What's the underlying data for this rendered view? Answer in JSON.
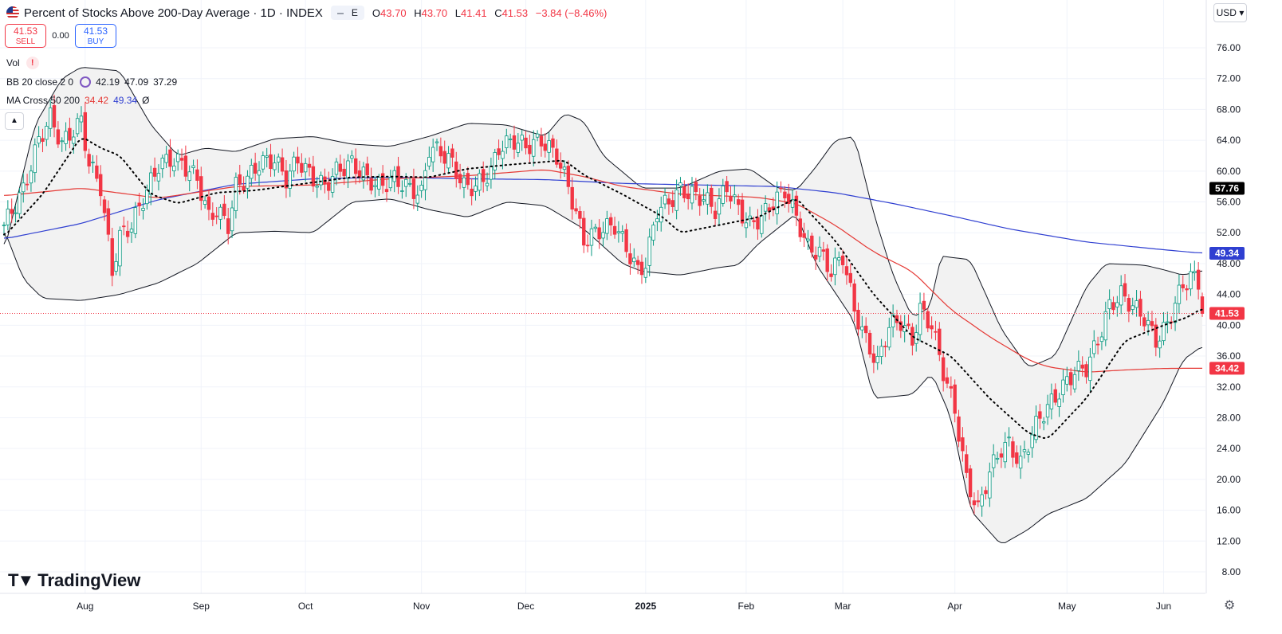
{
  "header": {
    "title": "Percent of Stocks Above 200-Day Average · 1D · INDEX",
    "badge": "E",
    "ohlc": [
      {
        "k": "O",
        "v": "43.70"
      },
      {
        "k": "H",
        "v": "43.70"
      },
      {
        "k": "L",
        "v": "41.41"
      },
      {
        "k": "C",
        "v": "41.53"
      }
    ],
    "change": "−3.84 (−8.46%)"
  },
  "trade": {
    "sell_price": "41.53",
    "sell_label": "SELL",
    "spread": "0.00",
    "buy_price": "41.53",
    "buy_label": "BUY"
  },
  "indicators": {
    "vol": "Vol",
    "bb_label": "BB 20 close 2 0",
    "bb_values": [
      "42.19",
      "47.09",
      "37.29"
    ],
    "ma_label": "MA Cross 50 200",
    "ma_values": [
      "34.42",
      "49.34"
    ],
    "ma_extra": "Ø"
  },
  "currency": "USD",
  "brand": "TradingView",
  "colors": {
    "up": "#089981",
    "down": "#f23645",
    "ma50": "#e53935",
    "ma200": "#2f3fd1",
    "bb": "#131722",
    "bb_fill": "#f2f2f2",
    "basis": "#000000"
  },
  "chart_data": {
    "type": "candlestick",
    "ylim": [
      6,
      78
    ],
    "yticks": [
      76,
      72,
      68,
      64,
      60,
      56,
      52,
      48,
      44,
      40,
      36,
      32,
      28,
      24,
      20,
      16,
      12,
      8
    ],
    "x_labels": [
      "Aug",
      "Sep",
      "Oct",
      "Nov",
      "Dec",
      "2025",
      "Feb",
      "Mar",
      "Apr",
      "May",
      "Jun"
    ],
    "x_label_index": [
      21,
      51,
      78,
      108,
      135,
      166,
      192,
      217,
      246,
      275,
      300
    ],
    "last_value": 41.53,
    "value_labels": [
      {
        "v": 57.76,
        "text": "57.76",
        "color": "#000000"
      },
      {
        "v": 49.34,
        "text": "49.34",
        "color": "#2f3fd1"
      },
      {
        "v": 41.53,
        "text": "41.53",
        "color": "#f23645"
      },
      {
        "v": 34.42,
        "text": "34.42",
        "color": "#f23645"
      }
    ],
    "ma50_anchors": [
      [
        0,
        56.8
      ],
      [
        20,
        57.8
      ],
      [
        40,
        56.5
      ],
      [
        60,
        58.0
      ],
      [
        80,
        58.2
      ],
      [
        100,
        59.0
      ],
      [
        120,
        59.4
      ],
      [
        140,
        60.2
      ],
      [
        150,
        59.3
      ],
      [
        160,
        58.0
      ],
      [
        175,
        57.0
      ],
      [
        195,
        56.6
      ],
      [
        205,
        55.8
      ],
      [
        215,
        53.0
      ],
      [
        225,
        49.5
      ],
      [
        235,
        47.0
      ],
      [
        245,
        42.0
      ],
      [
        255,
        38.5
      ],
      [
        265,
        35.5
      ],
      [
        270,
        34.6
      ],
      [
        280,
        33.9
      ],
      [
        290,
        34.2
      ],
      [
        300,
        34.4
      ],
      [
        310,
        34.42
      ]
    ],
    "ma200_anchors": [
      [
        0,
        51.2
      ],
      [
        20,
        53.2
      ],
      [
        40,
        56.3
      ],
      [
        60,
        58.3
      ],
      [
        80,
        59.0
      ],
      [
        100,
        59.2
      ],
      [
        120,
        59.0
      ],
      [
        140,
        58.9
      ],
      [
        160,
        58.4
      ],
      [
        180,
        58.2
      ],
      [
        200,
        58.0
      ],
      [
        215,
        57.2
      ],
      [
        230,
        55.8
      ],
      [
        245,
        54.2
      ],
      [
        260,
        52.5
      ],
      [
        280,
        50.8
      ],
      [
        300,
        49.8
      ],
      [
        310,
        49.34
      ]
    ],
    "basis_anchors": [
      [
        0,
        51.5
      ],
      [
        10,
        57
      ],
      [
        20,
        64.5
      ],
      [
        25,
        63
      ],
      [
        30,
        62
      ],
      [
        38,
        57
      ],
      [
        45,
        55.8
      ],
      [
        55,
        57.2
      ],
      [
        65,
        57.5
      ],
      [
        75,
        58.2
      ],
      [
        90,
        59.2
      ],
      [
        100,
        59.3
      ],
      [
        110,
        59.2
      ],
      [
        120,
        60.3
      ],
      [
        130,
        60.8
      ],
      [
        140,
        61.2
      ],
      [
        145,
        61.4
      ],
      [
        150,
        59.5
      ],
      [
        160,
        57.0
      ],
      [
        170,
        54.2
      ],
      [
        175,
        52.0
      ],
      [
        185,
        53.0
      ],
      [
        195,
        54.0
      ],
      [
        205,
        56.5
      ],
      [
        215,
        51.0
      ],
      [
        225,
        44.0
      ],
      [
        235,
        38.5
      ],
      [
        245,
        36.0
      ],
      [
        255,
        30.5
      ],
      [
        265,
        26.0
      ],
      [
        270,
        25.2
      ],
      [
        280,
        30.5
      ],
      [
        290,
        38.0
      ],
      [
        300,
        40.0
      ],
      [
        306,
        41.0
      ],
      [
        310,
        42.19
      ]
    ],
    "upper_anchors": [
      [
        0,
        49.5
      ],
      [
        8,
        66
      ],
      [
        15,
        72
      ],
      [
        20,
        73.5
      ],
      [
        30,
        73
      ],
      [
        38,
        66
      ],
      [
        45,
        62
      ],
      [
        52,
        63
      ],
      [
        60,
        62.5
      ],
      [
        70,
        64.2
      ],
      [
        80,
        64.5
      ],
      [
        90,
        63.5
      ],
      [
        100,
        63.2
      ],
      [
        110,
        64.5
      ],
      [
        120,
        66.2
      ],
      [
        130,
        66.0
      ],
      [
        140,
        64.5
      ],
      [
        145,
        67.5
      ],
      [
        150,
        66.5
      ],
      [
        155,
        62
      ],
      [
        165,
        57.8
      ],
      [
        175,
        57.8
      ],
      [
        185,
        60.0
      ],
      [
        193,
        60.3
      ],
      [
        200,
        57.8
      ],
      [
        205,
        57.5
      ],
      [
        210,
        60.5
      ],
      [
        215,
        64.0
      ],
      [
        220,
        64.5
      ],
      [
        225,
        54.5
      ],
      [
        230,
        46.5
      ],
      [
        235,
        41.0
      ],
      [
        240,
        42.5
      ],
      [
        242,
        49.0
      ],
      [
        250,
        48.5
      ],
      [
        258,
        39.5
      ],
      [
        265,
        34.5
      ],
      [
        272,
        36.0
      ],
      [
        280,
        45.0
      ],
      [
        285,
        48.0
      ],
      [
        295,
        47.8
      ],
      [
        300,
        47.2
      ],
      [
        305,
        46.5
      ],
      [
        310,
        47.09
      ]
    ],
    "lower_anchors": [
      [
        0,
        52.5
      ],
      [
        5,
        46
      ],
      [
        10,
        43.5
      ],
      [
        20,
        43.2
      ],
      [
        30,
        44.0
      ],
      [
        40,
        45.5
      ],
      [
        50,
        48.0
      ],
      [
        60,
        52.0
      ],
      [
        70,
        52.2
      ],
      [
        80,
        52.0
      ],
      [
        90,
        56.0
      ],
      [
        100,
        56.4
      ],
      [
        110,
        55.0
      ],
      [
        120,
        54.0
      ],
      [
        130,
        56.0
      ],
      [
        140,
        55.5
      ],
      [
        150,
        52.5
      ],
      [
        160,
        48.0
      ],
      [
        165,
        47.0
      ],
      [
        175,
        46.5
      ],
      [
        185,
        47.5
      ],
      [
        190,
        47.8
      ],
      [
        195,
        50.5
      ],
      [
        205,
        54.5
      ],
      [
        210,
        48.0
      ],
      [
        220,
        40.5
      ],
      [
        225,
        30.5
      ],
      [
        235,
        31.0
      ],
      [
        240,
        33.8
      ],
      [
        245,
        28.0
      ],
      [
        250,
        16.0
      ],
      [
        258,
        11.5
      ],
      [
        265,
        13.5
      ],
      [
        270,
        15.5
      ],
      [
        280,
        17.5
      ],
      [
        290,
        22.0
      ],
      [
        300,
        30.0
      ],
      [
        305,
        35.5
      ],
      [
        310,
        37.29
      ]
    ],
    "close_anchors": [
      [
        0,
        53.0
      ],
      [
        5,
        57.5
      ],
      [
        9,
        64
      ],
      [
        12,
        67
      ],
      [
        15,
        63.5
      ],
      [
        20,
        66.5
      ],
      [
        22,
        61
      ],
      [
        25,
        58
      ],
      [
        28,
        47
      ],
      [
        30,
        51.5
      ],
      [
        33,
        53
      ],
      [
        37,
        57.5
      ],
      [
        40,
        60.8
      ],
      [
        43,
        61.5
      ],
      [
        46,
        61
      ],
      [
        50,
        59
      ],
      [
        53,
        54
      ],
      [
        55,
        55
      ],
      [
        58,
        53
      ],
      [
        60,
        58
      ],
      [
        63,
        59
      ],
      [
        66,
        61
      ],
      [
        70,
        61.5
      ],
      [
        73,
        59
      ],
      [
        76,
        61.5
      ],
      [
        80,
        59
      ],
      [
        83,
        58
      ],
      [
        86,
        60
      ],
      [
        90,
        61
      ],
      [
        94,
        59
      ],
      [
        97,
        58
      ],
      [
        101,
        59
      ],
      [
        104,
        58
      ],
      [
        108,
        57
      ],
      [
        110,
        63
      ],
      [
        113,
        62.5
      ],
      [
        116,
        61
      ],
      [
        119,
        58
      ],
      [
        122,
        58
      ],
      [
        126,
        60
      ],
      [
        128,
        63
      ],
      [
        130,
        63.5
      ],
      [
        132,
        64
      ],
      [
        135,
        63.2
      ],
      [
        139,
        64
      ],
      [
        143,
        62
      ],
      [
        146,
        58
      ],
      [
        150,
        51
      ],
      [
        153,
        52
      ],
      [
        155,
        52.5
      ],
      [
        158,
        53
      ],
      [
        161,
        50
      ],
      [
        164,
        47
      ],
      [
        166,
        48
      ],
      [
        169,
        55
      ],
      [
        172,
        56
      ],
      [
        175,
        57.5
      ],
      [
        178,
        57
      ],
      [
        181,
        56.5
      ],
      [
        184,
        55
      ],
      [
        187,
        58
      ],
      [
        190,
        55
      ],
      [
        193,
        53
      ],
      [
        196,
        54
      ],
      [
        199,
        56
      ],
      [
        202,
        57.5
      ],
      [
        205,
        54
      ],
      [
        208,
        50
      ],
      [
        211,
        49.5
      ],
      [
        214,
        47
      ],
      [
        217,
        49
      ],
      [
        220,
        42
      ],
      [
        223,
        38
      ],
      [
        226,
        35
      ],
      [
        229,
        40
      ],
      [
        232,
        40.5
      ],
      [
        235,
        38
      ],
      [
        237,
        42
      ],
      [
        240,
        40
      ],
      [
        243,
        34
      ],
      [
        246,
        29
      ],
      [
        249,
        20
      ],
      [
        252,
        16
      ],
      [
        255,
        21
      ],
      [
        258,
        24
      ],
      [
        260,
        24.5
      ],
      [
        263,
        22
      ],
      [
        266,
        26
      ],
      [
        268,
        28
      ],
      [
        271,
        30
      ],
      [
        274,
        32
      ],
      [
        277,
        34
      ],
      [
        280,
        34.5
      ],
      [
        283,
        38
      ],
      [
        286,
        42.5
      ],
      [
        289,
        44
      ],
      [
        292,
        42.5
      ],
      [
        295,
        41
      ],
      [
        298,
        38
      ],
      [
        301,
        40
      ],
      [
        303,
        43
      ],
      [
        305,
        45
      ],
      [
        307,
        46.5
      ],
      [
        309,
        45.4
      ],
      [
        310,
        41.53
      ]
    ]
  }
}
